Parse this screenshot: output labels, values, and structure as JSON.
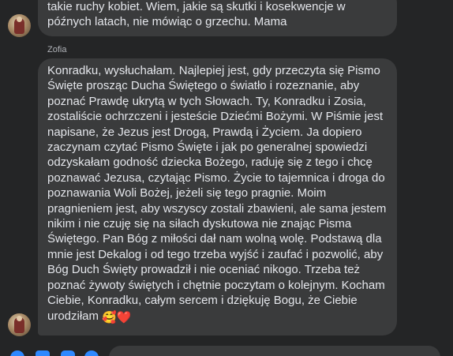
{
  "messages": {
    "previous": {
      "lines": [
        "takie ruchy kobiet. Wiem, jakie są skutki i kosekwencje w",
        "późnych latach, nie mówiąc o grzechu. Mama"
      ]
    },
    "current": {
      "sender": "Zofia",
      "lines": [
        "Konradku, wysłuchałam. Najlepiej jest, gdy przeczyta się Pismo",
        "Święte prosząc Ducha Świętego o światło i rozeznanie, aby",
        "poznać Prawdę ukrytą w tych Słowach. Ty, Konradku i Zosia,",
        "zostaliście ochrzczeni i jesteście Dziećmi Bożymi. W Piśmie jest",
        "napisane, że Jezus jest Drogą, Prawdą i Życiem. Ja dopiero",
        "zaczynam czytać Pismo Święte i jak po generalnej spowiedzi",
        "odzyskałam godność dziecka Bożego, raduję się z tego i chcę",
        "poznawać Jezusa, czytając Pismo. Życie to tajemnica i droga do",
        "poznawania Woli Bożej, jeżeli się tego pragnie. Moim",
        "pragnieniem jest, aby wszyscy zostali zbawieni, ale sama jestem",
        "nikim i nie czuję się na siłach dyskutowa nie znając Pisma",
        "Świętego. Pan Bóg z miłości dał nam wolną wolę. Podstawą dla",
        "mnie jest Dekalog i od tego trzeba wyjść i zaufać i pozwolić, aby",
        "Bóg Duch Święty prowadził i nie oceniać nikogo. Trzeba też",
        "poznać żywoty świętych i chętnie poczytam o kolejnym. Kocham",
        "Ciebie, Konradku, całym sercem i dziękuję Bogu, że Ciebie",
        "urodziłam"
      ],
      "emoji": [
        "🥰",
        "❤️"
      ]
    }
  },
  "colors": {
    "background": "#242526",
    "bubble": "#3a3b3c",
    "text": "#e4e6eb",
    "sender": "#b0b3b8",
    "accent": "#2d88ff"
  },
  "icons": {
    "avatar": "avatar-photo",
    "bottom_bar": [
      "plus-circle-icon",
      "gallery-icon",
      "sticker-icon",
      "emoji-icon"
    ]
  }
}
